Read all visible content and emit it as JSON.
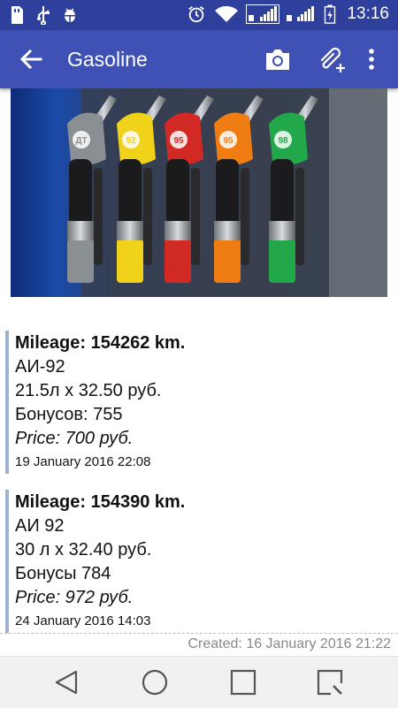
{
  "status_bar": {
    "time": "13:16",
    "icons": [
      "sd-card-icon",
      "usb-icon",
      "android-debug-icon",
      "alarm-icon",
      "wifi-icon",
      "signal-icon",
      "signal-icon-2",
      "battery-charging-icon"
    ]
  },
  "toolbar": {
    "title": "Gasoline",
    "back_icon": "arrow-back-icon",
    "camera_icon": "camera-icon",
    "attach_icon": "attachment-add-icon",
    "more_icon": "more-vert-icon"
  },
  "photo": {
    "nozzles": [
      {
        "label": "ДТ",
        "color": "#8a8f93"
      },
      {
        "label": "92",
        "color": "#f1d21a"
      },
      {
        "label": "95",
        "color": "#d12a25"
      },
      {
        "label": "95",
        "color": "#f07d14"
      },
      {
        "label": "98",
        "color": "#22a84a"
      }
    ]
  },
  "entries": [
    {
      "mileage": "Mileage: 154262 km.",
      "fuel": "АИ-92",
      "volume": "21.5л х 32.50 руб.",
      "bonus": "Бонусов: 755",
      "price": "Price: 700 руб.",
      "date": "19 January 2016 22:08"
    },
    {
      "mileage": "Mileage: 154390 km.",
      "fuel": "АИ 92",
      "volume": "30 л х 32.40 руб.",
      "bonus": "Бонусы 784",
      "price": "Price: 972 руб.",
      "date": "24 January 2016 14:03"
    }
  ],
  "footer": {
    "created": "Created: 16 January 2016 21:22"
  },
  "navbar": {
    "back_icon": "nav-back-icon",
    "home_icon": "nav-home-icon",
    "recents_icon": "nav-recents-icon",
    "notes_icon": "nav-capture-icon"
  },
  "colors": {
    "status_bar": "#2f3f9c",
    "toolbar": "#3f51b5",
    "entry_border": "#9fb3cf"
  }
}
